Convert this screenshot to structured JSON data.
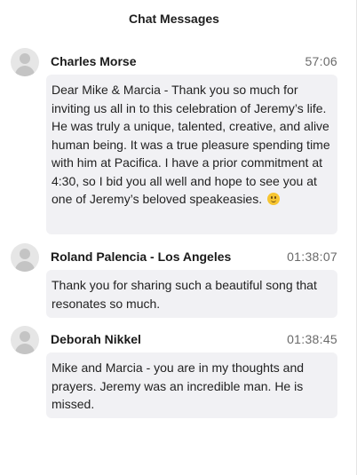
{
  "header": {
    "title": "Chat Messages"
  },
  "messages": [
    {
      "sender": "Charles Morse",
      "time": "57:06",
      "text": "Dear Mike & Marcia - Thank you so much for inviting us all in to this celebration of Jeremy’s life. He was truly a unique, talented, creative, and alive human being. It was a true pleasure spending time with him at Pacifica. I have a prior commitment at 4:30, so I bid you all well and hope to see you at one of Jeremy’s beloved speakeasies.",
      "emoji": "smiling-face-icon"
    },
    {
      "sender": "Roland Palencia - Los Angeles",
      "time": "01:38:07",
      "text": "Thank you for sharing such a beautiful song that resonates so much."
    },
    {
      "sender": "Deborah Nikkel",
      "time": "01:38:45",
      "text": "Mike and Marcia - you are in my thoughts and prayers. Jeremy was an incredible man. He is missed."
    }
  ]
}
